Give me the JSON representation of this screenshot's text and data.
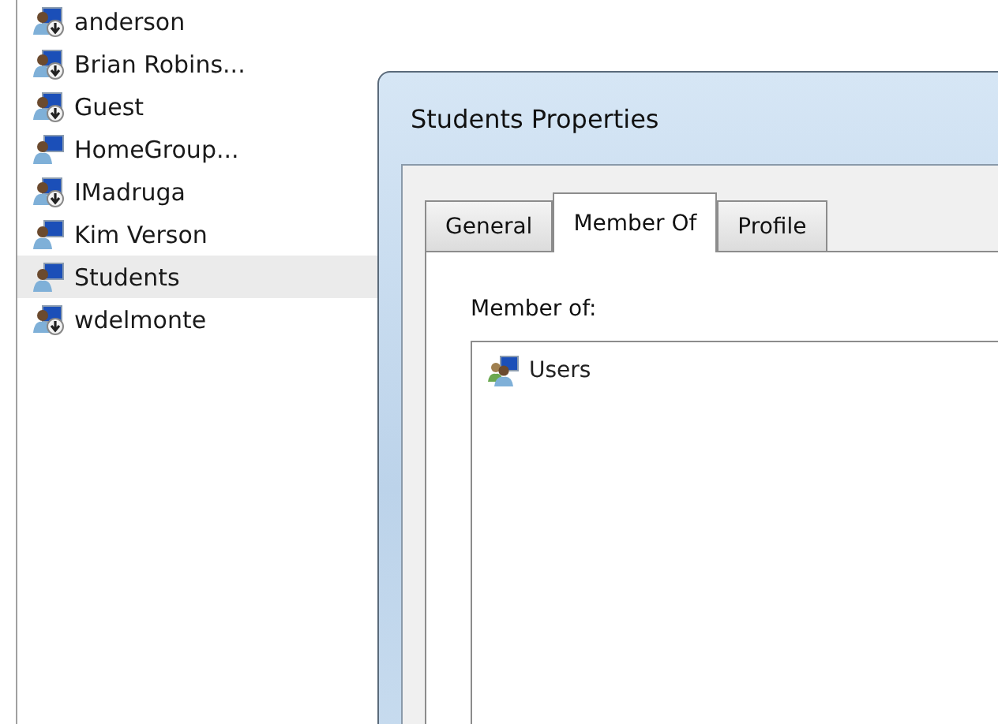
{
  "sidebar": {
    "items": [
      {
        "label": "anderson",
        "kind": "user",
        "selected": false
      },
      {
        "label": "Brian Robins...",
        "kind": "user",
        "selected": false
      },
      {
        "label": "Guest",
        "kind": "user",
        "selected": false
      },
      {
        "label": "HomeGroup...",
        "kind": "group",
        "selected": false
      },
      {
        "label": "IMadruga",
        "kind": "user",
        "selected": false
      },
      {
        "label": "Kim Verson",
        "kind": "group",
        "selected": false
      },
      {
        "label": "Students",
        "kind": "group",
        "selected": true
      },
      {
        "label": "wdelmonte",
        "kind": "user",
        "selected": false
      }
    ]
  },
  "dialog": {
    "title": "Students Properties",
    "tabs": [
      {
        "label": "General",
        "selected": false
      },
      {
        "label": "Member Of",
        "selected": true
      },
      {
        "label": "Profile",
        "selected": false
      }
    ],
    "member_of_label": "Member of:",
    "members": [
      {
        "label": "Users",
        "selected": false
      }
    ]
  }
}
